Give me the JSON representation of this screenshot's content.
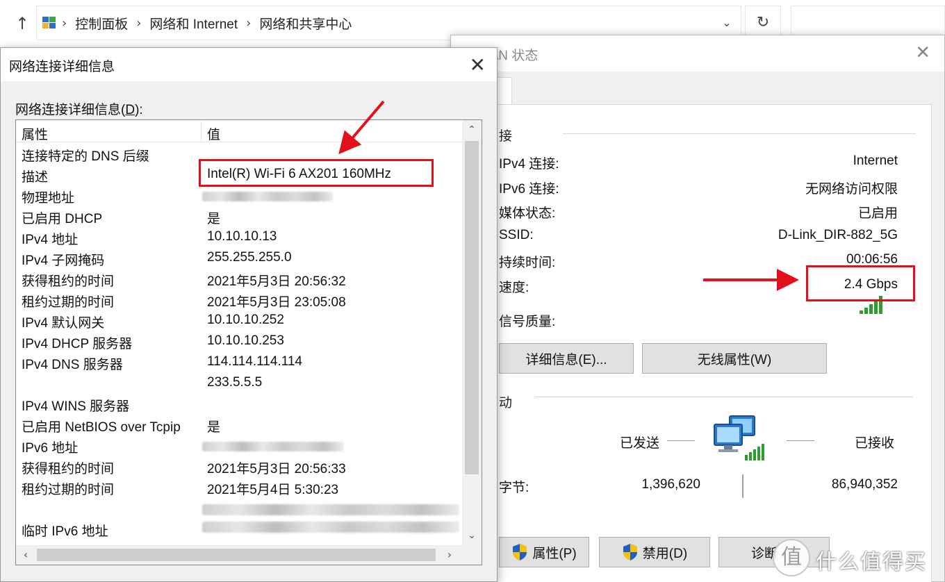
{
  "explorer": {
    "up_glyph": "↑",
    "breadcrumb": [
      "控制面板",
      "网络和 Internet",
      "网络和共享中心"
    ],
    "crumb_sep": "›",
    "dropdown_glyph": "⌄",
    "refresh_glyph": "↻"
  },
  "wlan_status": {
    "title": "LAN 状态",
    "close_glyph": "✕",
    "connection_section": "接",
    "rows": [
      {
        "label": "IPv4 连接:",
        "value": "Internet"
      },
      {
        "label": "IPv6 连接:",
        "value": "无网络访问权限"
      },
      {
        "label": "媒体状态:",
        "value": "已启用"
      },
      {
        "label": "SSID:",
        "value": "D-Link_DIR-882_5G"
      },
      {
        "label": "持续时间:",
        "value": "00:06:56"
      },
      {
        "label": "速度:",
        "value": "2.4 Gbps"
      }
    ],
    "signal_label": "信号质量:",
    "details_button": "详细信息(E)...",
    "wireless_props_button": "无线属性(W)",
    "activity_section": "动",
    "sent_label": "已发送",
    "received_label": "已接收",
    "bytes_label": "字节:",
    "bytes_sent": "1,396,620",
    "bytes_received": "86,940,352",
    "properties_button": "属性(P)",
    "disable_button": "禁用(D)",
    "diagnose_button": "诊断"
  },
  "details_dialog": {
    "title": "网络连接详细信息",
    "close_glyph": "✕",
    "caption_pre": "网络连接详细信息(",
    "caption_key": "D",
    "caption_post": "):",
    "col_property": "属性",
    "col_value": "值",
    "rows": [
      {
        "prop": "连接特定的 DNS 后缀",
        "value": ""
      },
      {
        "prop": "描述",
        "value": "Intel(R) Wi-Fi 6 AX201 160MHz"
      },
      {
        "prop": "物理地址",
        "value": ""
      },
      {
        "prop": "已启用 DHCP",
        "value": "是"
      },
      {
        "prop": "IPv4 地址",
        "value": "10.10.10.13"
      },
      {
        "prop": "IPv4 子网掩码",
        "value": "255.255.255.0"
      },
      {
        "prop": "获得租约的时间",
        "value": "2021年5月3日 20:56:32"
      },
      {
        "prop": "租约过期的时间",
        "value": "2021年5月3日 23:05:08"
      },
      {
        "prop": "IPv4 默认网关",
        "value": "10.10.10.252"
      },
      {
        "prop": "IPv4 DHCP 服务器",
        "value": "10.10.10.253"
      },
      {
        "prop": "IPv4 DNS 服务器",
        "value": "114.114.114.114"
      },
      {
        "prop": "",
        "value": "233.5.5.5"
      },
      {
        "prop": "IPv4 WINS 服务器",
        "value": ""
      },
      {
        "prop": "已启用 NetBIOS over Tcpip",
        "value": "是"
      },
      {
        "prop": "IPv6 地址",
        "value": ""
      },
      {
        "prop": "获得租约的时间",
        "value": "2021年5月3日 20:56:33"
      },
      {
        "prop": "租约过期的时间",
        "value": "2021年5月4日 5:30:23"
      },
      {
        "prop": "",
        "value": ""
      },
      {
        "prop": "临时 IPv6 地址",
        "value": ""
      }
    ],
    "scroll_up": "⌃",
    "scroll_down": "⌄",
    "scroll_left": "‹",
    "scroll_right": "›"
  },
  "watermark": {
    "logo_glyph": "值",
    "text": "什么值得买"
  },
  "colors": {
    "annotation_red": "#e3101c",
    "signal_green": "#2e9d2e",
    "window_gray": "#f0f0f0"
  }
}
